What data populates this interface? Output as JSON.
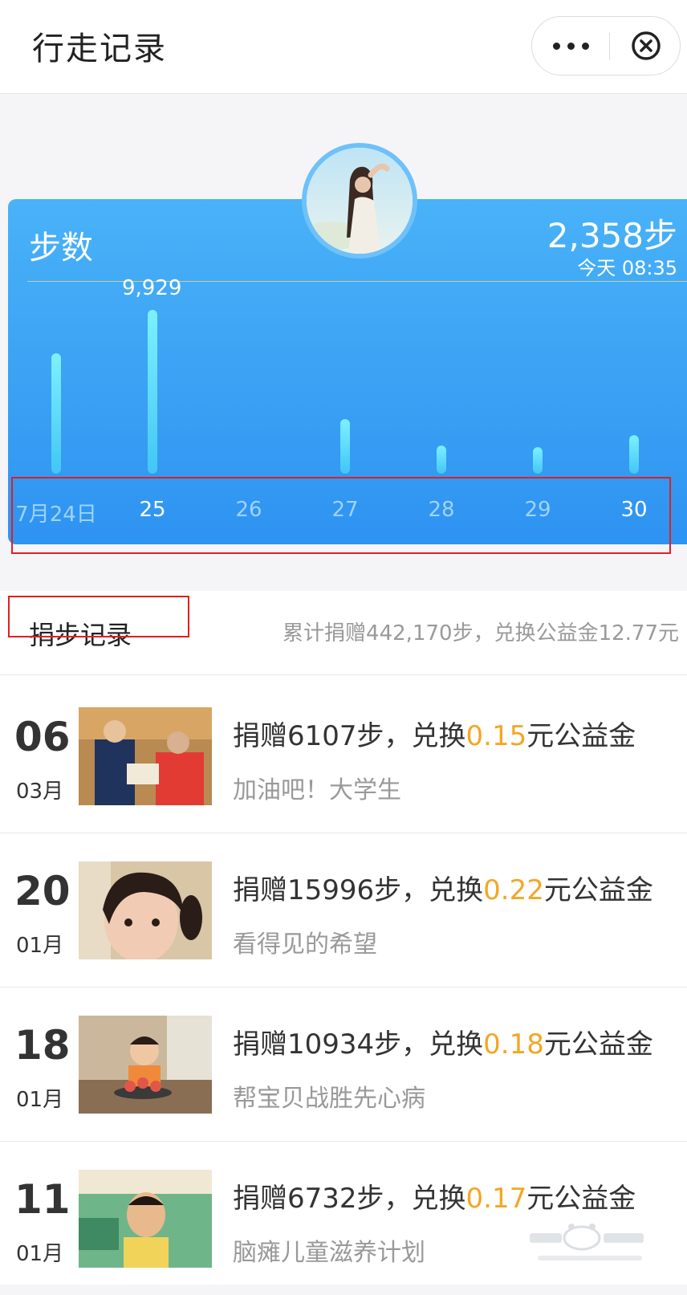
{
  "header": {
    "title": "行走记录",
    "more_icon": "more-dots-icon",
    "close_icon": "close-circle-icon"
  },
  "card": {
    "label": "步数",
    "today_steps": "2,358步",
    "today_time": "今天 08:35",
    "peak_label": "9,929"
  },
  "chart_data": {
    "type": "bar",
    "categories": [
      "7月24日",
      "25",
      "26",
      "27",
      "28",
      "29",
      "30"
    ],
    "values": [
      7300,
      9929,
      0,
      3300,
      1700,
      1600,
      2358
    ],
    "highlighted": [
      "25",
      "30"
    ],
    "bar_color": "#5fdcfb"
  },
  "records": {
    "title": "捐步记录",
    "summary": "累计捐赠442,170步，兑换公益金12.77元",
    "items": [
      {
        "day": "06",
        "month": "03月",
        "pre": "捐赠6107步，兑换",
        "amount": "0.15",
        "post": "元公益金",
        "subtitle": "加油吧！大学生"
      },
      {
        "day": "20",
        "month": "01月",
        "pre": "捐赠15996步，兑换",
        "amount": "0.22",
        "post": "元公益金",
        "subtitle": "看得见的希望"
      },
      {
        "day": "18",
        "month": "01月",
        "pre": "捐赠10934步，兑换",
        "amount": "0.18",
        "post": "元公益金",
        "subtitle": "帮宝贝战胜先心病"
      },
      {
        "day": "11",
        "month": "01月",
        "pre": "捐赠6732步，兑换",
        "amount": "0.17",
        "post": "元公益金",
        "subtitle": "脑瘫儿童滋养计划"
      }
    ]
  },
  "colors": {
    "accent": "#f5a623",
    "card_blue": "#3a9ff4"
  }
}
